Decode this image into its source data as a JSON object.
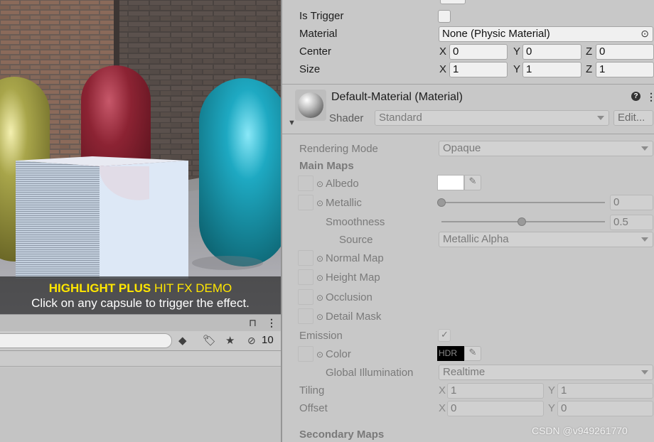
{
  "scene": {
    "caption_line1_bold": "HIGHLIGHT PLUS",
    "caption_line1_rest": " HIT FX DEMO",
    "caption_line2": "Click on any capsule to trigger the effect."
  },
  "project": {
    "hidden_count": "10"
  },
  "collider": {
    "is_trigger_label": "Is Trigger",
    "material_label": "Material",
    "material_value": "None (Physic Material)",
    "center_label": "Center",
    "center": {
      "x_label": "X",
      "x": "0",
      "y_label": "Y",
      "y": "0",
      "z_label": "Z",
      "z": "0"
    },
    "size_label": "Size",
    "size": {
      "x_label": "X",
      "x": "1",
      "y_label": "Y",
      "y": "1",
      "z_label": "Z",
      "z": "1"
    }
  },
  "material": {
    "title": "Default-Material (Material)",
    "shader_label": "Shader",
    "shader_value": "Standard",
    "edit_button": "Edit...",
    "rendering_mode_label": "Rendering Mode",
    "rendering_mode_value": "Opaque",
    "main_maps_label": "Main Maps",
    "albedo_label": "Albedo",
    "metallic_label": "Metallic",
    "metallic_value": "0",
    "smoothness_label": "Smoothness",
    "smoothness_value": "0.5",
    "smoothness_fraction": 0.5,
    "source_label": "Source",
    "source_value": "Metallic Alpha",
    "normal_map_label": "Normal Map",
    "height_map_label": "Height Map",
    "occlusion_label": "Occlusion",
    "detail_mask_label": "Detail Mask",
    "emission_label": "Emission",
    "emission_checked": true,
    "color_label": "Color",
    "hdr_label": "HDR",
    "global_illumination_label": "Global Illumination",
    "global_illumination_value": "Realtime",
    "tiling_label": "Tiling",
    "tiling": {
      "x_label": "X",
      "x": "1",
      "y_label": "Y",
      "y": "1"
    },
    "offset_label": "Offset",
    "offset": {
      "x_label": "X",
      "x": "0",
      "y_label": "Y",
      "y": "0"
    },
    "secondary_maps_label": "Secondary Maps"
  },
  "watermark": "CSDN @v949261770",
  "colors": {
    "caption_yellow": "#ffe600",
    "panel_bg": "#c8c8c8",
    "field_bg": "#f0f0f0"
  }
}
